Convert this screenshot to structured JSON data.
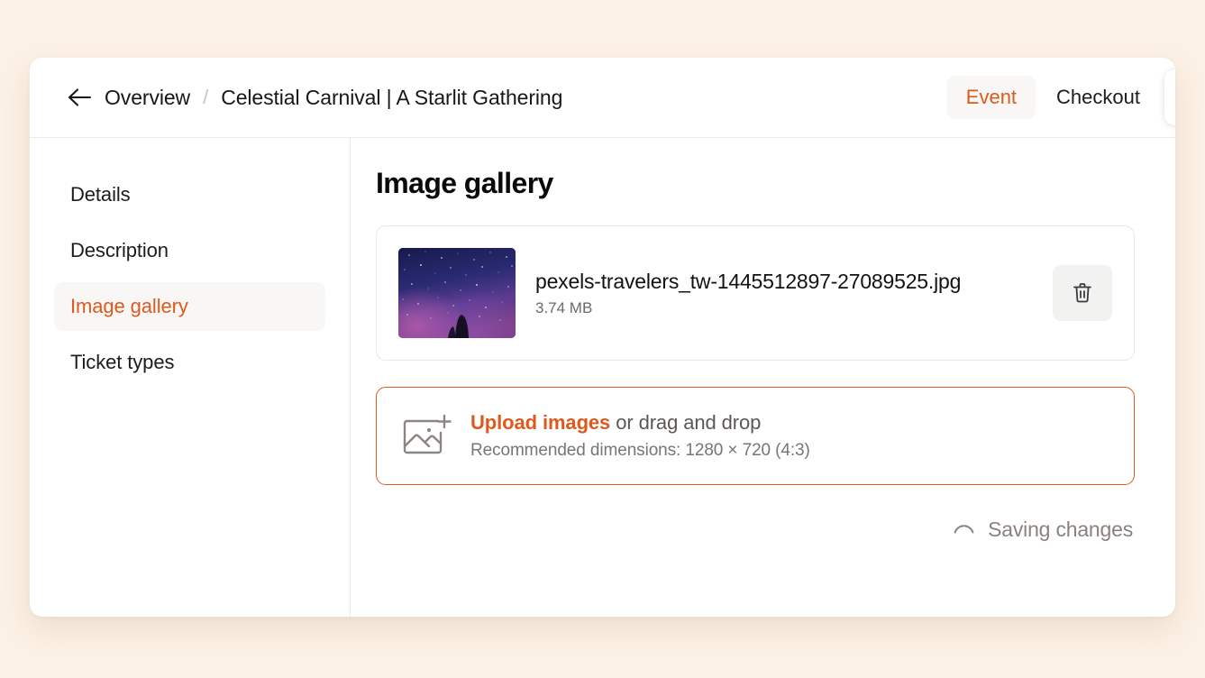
{
  "header": {
    "back_icon": "arrow-left-icon",
    "breadcrumb_root": "Overview",
    "breadcrumb_separator": "/",
    "breadcrumb_title": "Celestial Carnival | A Starlit Gathering",
    "tabs": [
      {
        "label": "Event",
        "active": true
      },
      {
        "label": "Checkout",
        "active": false
      }
    ]
  },
  "sidebar": {
    "items": [
      {
        "label": "Details",
        "active": false
      },
      {
        "label": "Description",
        "active": false
      },
      {
        "label": "Image gallery",
        "active": true
      },
      {
        "label": "Ticket types",
        "active": false
      }
    ]
  },
  "main": {
    "title": "Image gallery",
    "files": [
      {
        "name": "pexels-travelers_tw-1445512897-27089525.jpg",
        "size": "3.74 MB",
        "thumbnail_alt": "starry-night-sky-photo",
        "delete_icon": "trash-icon"
      }
    ],
    "dropzone": {
      "icon": "add-image-icon",
      "link_label": "Upload images",
      "rest_label": " or drag and drop",
      "hint": "Recommended dimensions: 1280 × 720 (4:3)"
    },
    "status": {
      "icon": "spinner-icon",
      "label": "Saving changes"
    }
  },
  "colors": {
    "accent": "#DC5A1E",
    "page_background": "#FCF1E5",
    "card_background": "#FFFFFF",
    "muted_text": "#7A7472"
  }
}
